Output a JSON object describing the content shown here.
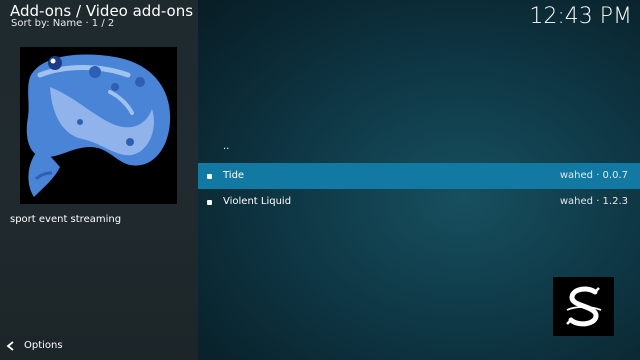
{
  "header": {
    "title": "Add-ons / Video add-ons",
    "sort_info": "Sort by: Name  ·  1 / 2",
    "clock": "12:43 PM"
  },
  "sidebar": {
    "thumbnail_icon": "fish-icon",
    "description": "sport event streaming",
    "options_label": "Options"
  },
  "list": {
    "parent_label": "..",
    "items": [
      {
        "label": "Tide",
        "meta": "wahed · 0.0.7",
        "selected": true
      },
      {
        "label": "Violent Liquid",
        "meta": "wahed · 1.2.3",
        "selected": false
      }
    ]
  },
  "colors": {
    "selection": "#127aa2",
    "sidebar_bg": "#212b2f",
    "main_bg": "#0f3846"
  },
  "corner_logo_icon": "s-logo-icon"
}
